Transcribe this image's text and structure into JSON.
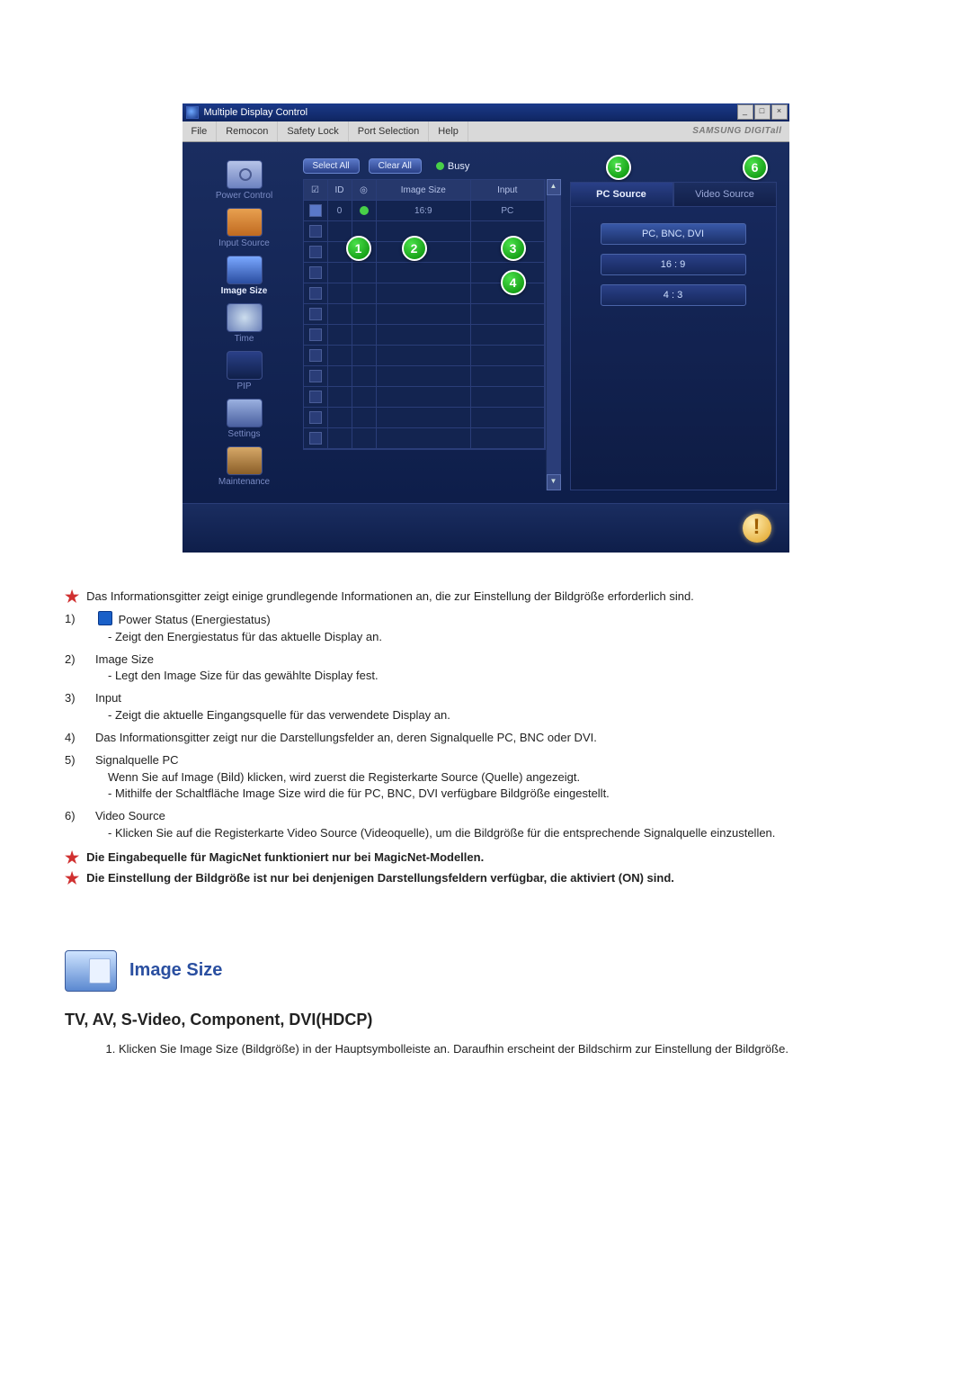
{
  "window": {
    "title": "Multiple Display Control",
    "menus": [
      "File",
      "Remocon",
      "Safety Lock",
      "Port Selection",
      "Help"
    ],
    "brand": "SAMSUNG DIGITall"
  },
  "leftnav": [
    {
      "label": "Power Control",
      "icon": "power"
    },
    {
      "label": "Input Source",
      "icon": "input"
    },
    {
      "label": "Image Size",
      "icon": "image",
      "active": true
    },
    {
      "label": "Time",
      "icon": "time"
    },
    {
      "label": "PIP",
      "icon": "pip"
    },
    {
      "label": "Settings",
      "icon": "settings"
    },
    {
      "label": "Maintenance",
      "icon": "maint"
    }
  ],
  "buttons": {
    "select_all": "Select All",
    "clear_all": "Clear All",
    "busy": "Busy"
  },
  "grid": {
    "headers": {
      "chk": "☑",
      "id": "ID",
      "power": "◎",
      "size": "Image Size",
      "input": "Input"
    },
    "rows": [
      {
        "checked": true,
        "id": "0",
        "power": true,
        "size": "16:9",
        "input": "PC"
      },
      {
        "checked": false
      },
      {
        "checked": false
      },
      {
        "checked": false
      },
      {
        "checked": false
      },
      {
        "checked": false
      },
      {
        "checked": false
      },
      {
        "checked": false
      },
      {
        "checked": false
      },
      {
        "checked": false
      },
      {
        "checked": false
      },
      {
        "checked": false
      }
    ]
  },
  "callouts": {
    "c1": "1",
    "c2": "2",
    "c3": "3",
    "c4": "4",
    "c5": "5",
    "c6": "6"
  },
  "right": {
    "tab_pc": "PC Source",
    "tab_video": "Video Source",
    "group": "PC, BNC, DVI",
    "btn_169": "16 : 9",
    "btn_43": "4 : 3"
  },
  "notes": {
    "intro": "Das Informationsgitter zeigt einige grundlegende Informationen an, die zur Einstellung der Bildgröße erforderlich sind.",
    "n1_title": "Power Status (Energiestatus)",
    "n1_body": "- Zeigt den Energiestatus für das aktuelle Display an.",
    "n2_title": "Image Size",
    "n2_body": "- Legt den Image Size für das gewählte Display fest.",
    "n3_title": "Input",
    "n3_body": "- Zeigt die aktuelle Eingangsquelle für das verwendete Display an.",
    "n4": "Das Informationsgitter zeigt nur die Darstellungsfelder an, deren Signalquelle PC, BNC oder DVI.",
    "n5_title": "Signalquelle PC",
    "n5_a": "Wenn Sie auf Image (Bild) klicken, wird zuerst die Registerkarte Source (Quelle) angezeigt.",
    "n5_b": "- Mithilfe der Schaltfläche Image Size wird die für PC, BNC, DVI verfügbare Bildgröße eingestellt.",
    "n6_title": "Video Source",
    "n6_body": "- Klicken Sie auf die Registerkarte Video Source (Videoquelle), um die Bildgröße für die entsprechende Signalquelle einzustellen.",
    "warn1": "Die Eingabequelle für MagicNet funktioniert nur bei MagicNet-Modellen.",
    "warn2": "Die Einstellung der Bildgröße ist nur bei denjenigen Darstellungsfeldern verfügbar, die aktiviert (ON) sind."
  },
  "section": {
    "heading": "Image Size",
    "subheading": "TV, AV, S-Video, Component, DVI(HDCP)",
    "step1": "Klicken Sie Image Size (Bildgröße) in der Hauptsymbolleiste an. Daraufhin erscheint der Bildschirm zur Einstellung der Bildgröße."
  }
}
